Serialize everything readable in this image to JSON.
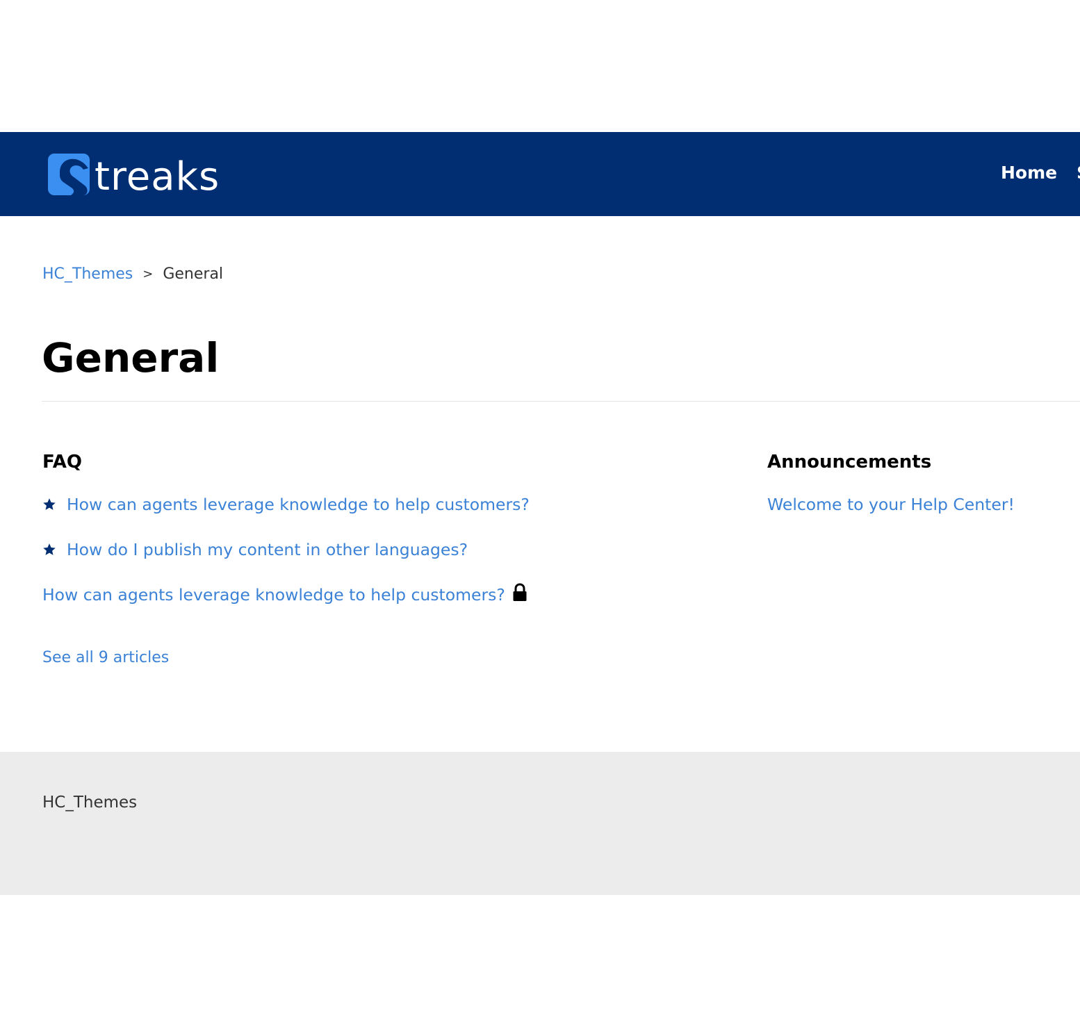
{
  "header": {
    "logo_text": "treaks",
    "nav": [
      "Home",
      "S"
    ]
  },
  "breadcrumb": {
    "root": "HC_Themes",
    "separator": ">",
    "current": "General"
  },
  "page": {
    "title": "General"
  },
  "faq": {
    "title": "FAQ",
    "articles": [
      {
        "label": "How can agents leverage knowledge to help customers?",
        "promoted": true,
        "locked": false
      },
      {
        "label": "How do I publish my content in other languages?",
        "promoted": true,
        "locked": false
      },
      {
        "label": "How can agents leverage knowledge to help customers?",
        "promoted": false,
        "locked": true
      }
    ],
    "see_all": "See all 9 articles"
  },
  "announcements": {
    "title": "Announcements",
    "articles": [
      {
        "label": "Welcome to your Help Center!"
      }
    ]
  },
  "footer": {
    "brand": "HC_Themes"
  },
  "colors": {
    "header_bg": "#012e73",
    "logo_accent": "#3b8ff0",
    "link": "#3b82d6",
    "footer_bg": "#ececec"
  },
  "icons": {
    "logo": "streaks-logo-icon",
    "promoted": "star-icon",
    "locked": "lock-icon"
  }
}
